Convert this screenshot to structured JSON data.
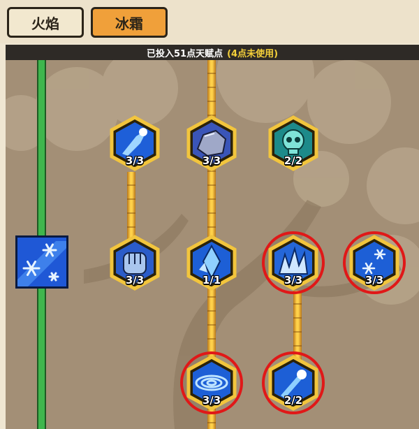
{
  "tabs": [
    {
      "label": "火焰",
      "active": false
    },
    {
      "label": "冰霜",
      "active": true
    }
  ],
  "summary": {
    "invested": "已投入51点天赋点",
    "unused": "(4点未使用)"
  },
  "nodes": [
    {
      "id": "n1",
      "level": "3/3",
      "icon": "ice-spark-icon"
    },
    {
      "id": "n2",
      "level": "3/3",
      "icon": "frost-rock-icon"
    },
    {
      "id": "n3",
      "level": "2/2",
      "icon": "frost-skull-icon"
    },
    {
      "id": "n4",
      "level": "3/3",
      "icon": "ice-fist-icon"
    },
    {
      "id": "n5",
      "level": "1/1",
      "icon": "ice-shard-icon"
    },
    {
      "id": "n6",
      "level": "3/3",
      "icon": "ice-spikes-icon"
    },
    {
      "id": "n7",
      "level": "3/3",
      "icon": "snowflakes-icon"
    },
    {
      "id": "n8",
      "level": "3/3",
      "icon": "ice-vortex-icon"
    },
    {
      "id": "n9",
      "level": "2/2",
      "icon": "ice-comet-icon"
    }
  ],
  "side_skill": {
    "icon": "blizzard-skill-icon"
  },
  "colors": {
    "tab_active": "#f0a03a",
    "strip_bg": "#2e2a26",
    "highlight_text": "#f6d13a",
    "connector": "#ffd14a",
    "tier_bar": "#3fb64d",
    "ring": "#e01818"
  }
}
